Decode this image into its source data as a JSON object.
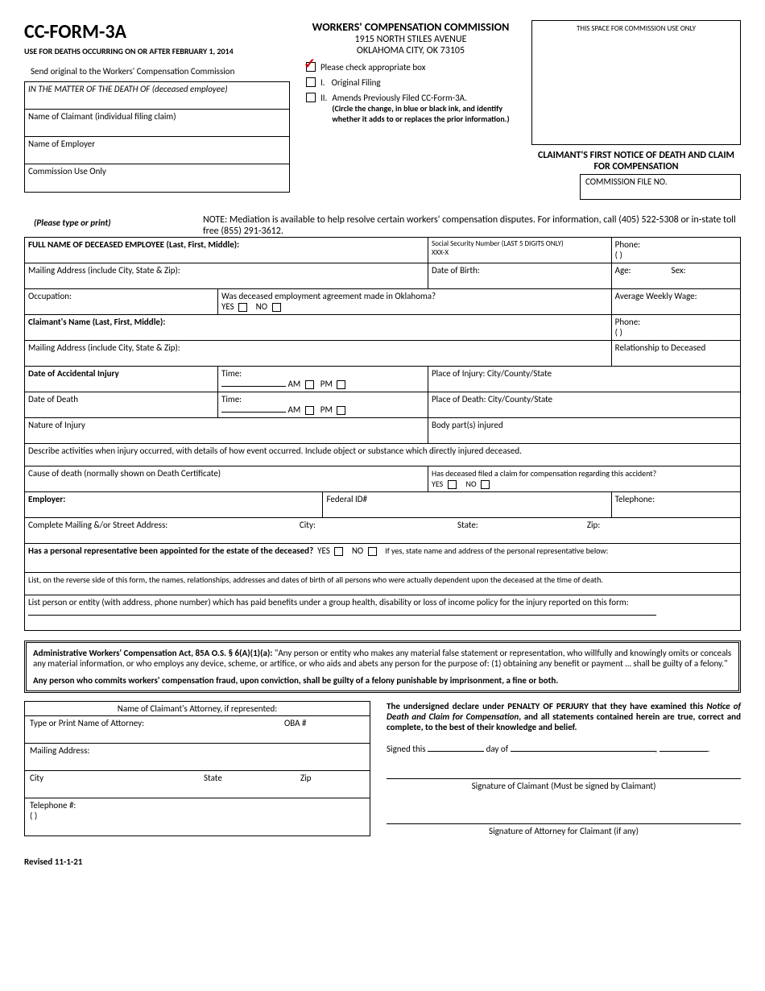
{
  "header": {
    "form_title": "CC-FORM-3A",
    "form_subtitle": "USE FOR DEATHS OCCURRING ON OR AFTER FEBRUARY 1, 2014",
    "commission_title": "WORKERS' COMPENSATION COMMISSION",
    "address1": "1915 NORTH STILES AVENUE",
    "address2": "OKLAHOMA CITY, OK 73105",
    "use_box": "THIS SPACE FOR COMMISSION USE ONLY",
    "send_note": "Send original to the Workers' Compensation Commission",
    "check_label": "Please check appropriate box",
    "opt1_num": "I.",
    "opt1": "Original Filing",
    "opt2_num": "II.",
    "opt2": "Amends Previously Filed CC-Form-3A.",
    "opt2_note": "(Circle the change, in blue or black ink, and identify whether it adds to or replaces the prior information.)"
  },
  "matter": {
    "row1": "IN THE MATTER OF THE DEATH OF (deceased employee)",
    "row2": "Name of Claimant (individual filing claim)",
    "row3": "Name of Employer",
    "row4": "Commission Use Only"
  },
  "section_title": "CLAIMANT'S FIRST NOTICE OF DEATH AND CLAIM FOR COMPENSATION",
  "file_no": "COMMISSION FILE NO.",
  "type_print": "(Please type or print)",
  "note": "NOTE:  Mediation is available to help resolve certain workers' compensation disputes. For information, call (405) 522-5308 or in-state toll free (855) 291-3612.",
  "fields": {
    "full_name": "FULL NAME OF DECEASED EMPLOYEE (Last, First, Middle):",
    "ssn": "Social Security Number (LAST 5 DIGITS ONLY)",
    "ssn_prefix": "XXX-X",
    "phone": "Phone:",
    "phone_paren": "(            )",
    "mailing": "Mailing Address (include City, State & Zip):",
    "dob": "Date of Birth:",
    "age": "Age:",
    "sex": "Sex:",
    "occupation": "Occupation:",
    "ok_agreement": "Was deceased employment agreement made in Oklahoma?",
    "yes": "YES",
    "no": "NO",
    "avg_wage": "Average Weekly Wage:",
    "claimant_name": "Claimant's Name (Last, First, Middle):",
    "relationship": "Relationship to Deceased",
    "date_injury": "Date of Accidental Injury",
    "time": "Time:",
    "am": "AM",
    "pm": "PM",
    "place_injury": "Place of Injury:   City/County/State",
    "date_death": "Date of Death",
    "place_death": "Place of Death:   City/County/State",
    "nature": "Nature of Injury",
    "body_parts": "Body part(s) injured",
    "describe": "Describe activities when injury occurred, with details of how event occurred.  Include object or substance which directly injured deceased.",
    "cause_death": "Cause of death (normally shown on Death Certificate)",
    "prior_claim": "Has deceased filed a claim for compensation regarding this accident?",
    "employer": "Employer:",
    "fed_id": "Federal ID#",
    "telephone": "Telephone:",
    "complete_addr": "Complete Mailing &/or Street Address:",
    "city": "City:",
    "state": "State:",
    "zip": "Zip:",
    "rep_question": "Has a personal representative been appointed for the estate of the deceased?",
    "rep_note": "If yes, state name and address of the personal  representative below:",
    "dependents": "List, on the reverse side of this form, the names, relationships, addresses and dates of birth of all persons who were actually dependent upon the deceased at the time of death.",
    "benefits": "List person or entity (with address, phone number) which has paid benefits under a group health, disability or loss of income policy for the injury reported on this form:"
  },
  "legal": {
    "citation": "Administrative Workers' Compensation Act, 85A O.S. § 6(A)(1)(a):",
    "text": "\"Any person or entity who makes any material false statement or representation, who willfully and knowingly omits or conceals any material information, or who employs any device, scheme, or  artifice, or who aids and abets any person for the purpose of: (1) obtaining any benefit or payment … shall be guilty of a felony.\"",
    "fraud": "Any person who commits workers' compensation fraud, upon conviction, shall be guilty of a felony punishable by imprisonment, a fine or both."
  },
  "attorney": {
    "header": "Name of Claimant's Attorney, if represented:",
    "name_label": "Type or Print Name of Attorney:",
    "oba": "OBA #",
    "mailing": "Mailing Address:",
    "city": "City",
    "state": "State",
    "zip": "Zip",
    "phone": "Telephone #:",
    "phone_paren": "(           )"
  },
  "perjury": {
    "text1": "The undersigned declare under PENALTY OF PERJURY that they have examined this ",
    "text2": "Notice of Death and Claim for Compensation",
    "text3": ", and all statements contained herein are true, correct and complete, to the best of their knowledge and belief.",
    "signed": "Signed this",
    "day_of": "day of",
    "sig1": "Signature of Claimant (Must be signed by Claimant)",
    "sig2": "Signature of Attorney for Claimant (if any)"
  },
  "revised": "Revised 11-1-21"
}
